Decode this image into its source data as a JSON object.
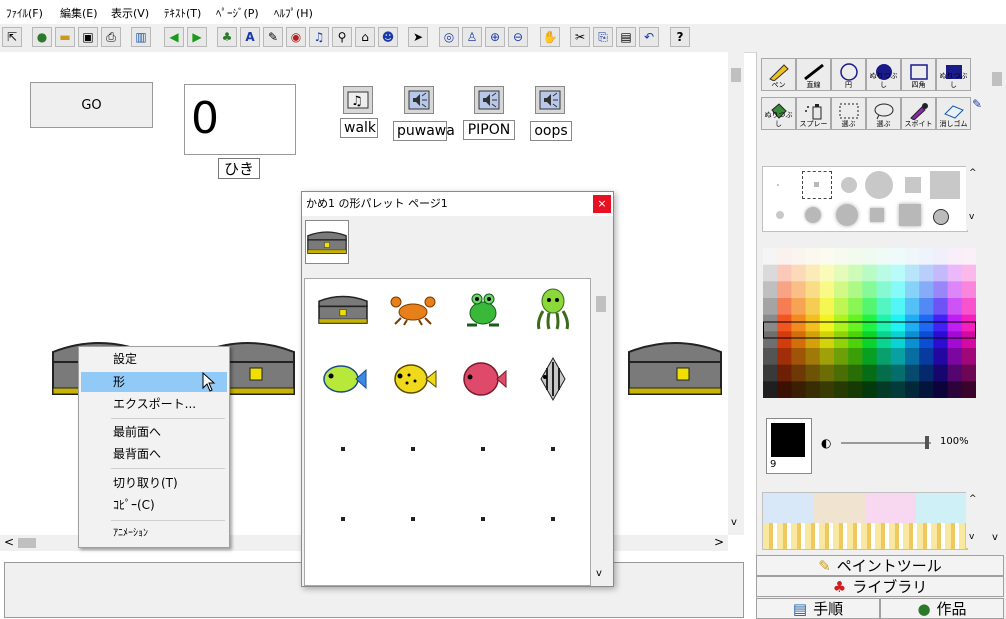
{
  "menubar": [
    "ﾌｧｲﾙ(F)",
    "編集(E)",
    "表示(V)",
    "ﾃｷｽﾄ(T)",
    "ﾍﾟｰｼﾞ(P)",
    "ﾍﾙﾌﾟ(H)"
  ],
  "toolbar_icons": [
    "pointer-icon",
    "globe-icon",
    "open-folder-icon",
    "save-icon",
    "print-icon",
    "layout-icon",
    "back-arrow-icon",
    "forward-arrow-icon",
    "character-icon",
    "text-icon",
    "hand-icon",
    "eye-mask-icon",
    "music-icon",
    "syringe-icon",
    "camera-icon",
    "robot-icon",
    "select-arrow-icon",
    "eye-icon",
    "stamp-icon",
    "zoom-in-icon",
    "zoom-out-icon",
    "stop-icon",
    "cut-icon",
    "copy-icon",
    "paste-icon",
    "undo-icon",
    "help-icon"
  ],
  "toolbar_help": "?",
  "stage": {
    "go_button": "GO",
    "counter_value": "0",
    "counter_label": "ひき",
    "sounds": [
      "walk",
      "puwawa",
      "PIPON",
      "oops"
    ]
  },
  "context_menu": {
    "items": [
      {
        "label": "設定",
        "selected": false
      },
      {
        "label": "形",
        "selected": true
      },
      {
        "label": "エクスポート...",
        "selected": false
      },
      {
        "label": "最前面へ",
        "selected": false
      },
      {
        "label": "最背面へ",
        "selected": false
      },
      {
        "label": "切り取り(T)",
        "selected": false
      },
      {
        "label": "ｺﾋﾟｰ(C)",
        "selected": false
      },
      {
        "label": "ｱﾆﾒｰｼｮﾝ",
        "selected": false
      }
    ]
  },
  "palette": {
    "title": "かめ1 の形パレット ページ1",
    "close": "×",
    "shapes": [
      "treasure-chest",
      "crab",
      "frog",
      "octopus",
      "green-fish",
      "yellow-fish",
      "red-fish",
      "angelfish"
    ]
  },
  "paint": {
    "tools_row1": [
      "ペン",
      "直線",
      "円",
      "ぬりつぶし",
      "四角",
      "ぬりつぶし"
    ],
    "tools_row2": [
      "ぬりつぶし",
      "スプレー",
      "選ぶ",
      "選ぶ",
      "スポイト",
      "消しゴム"
    ],
    "brush_size": "9",
    "opacity": "100%",
    "current_color": "#000000"
  },
  "tabs": {
    "paint_tools": "ペイントツール",
    "library": "ライブラリ",
    "procedure": "手順",
    "works": "作品"
  },
  "scroll_arrows": {
    "left": "<",
    "right": ">",
    "up": "^",
    "down": "v"
  }
}
